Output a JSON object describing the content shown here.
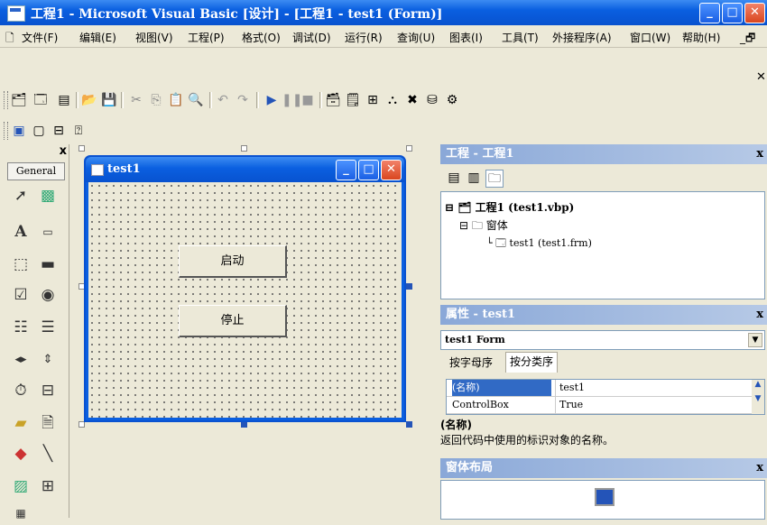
{
  "window": {
    "title": "工程1 - Microsoft Visual Basic [设计] - [工程1 - test1 (Form)]"
  },
  "menu": [
    "文件(F)",
    "编辑(E)",
    "视图(V)",
    "工程(P)",
    "格式(O)",
    "调试(D)",
    "运行(R)",
    "查询(U)",
    "图表(I)",
    "工具(T)",
    "外接程序(A)",
    "窗口(W)",
    "帮助(H)"
  ],
  "toolbox": {
    "tab_label": "General",
    "close": "x"
  },
  "form": {
    "title": "test1",
    "buttons": [
      {
        "label": "启动"
      },
      {
        "label": "停止"
      }
    ]
  },
  "project_panel": {
    "title": "工程 - 工程1",
    "close": "x",
    "tree": {
      "project": "工程1 (test1.vbp)",
      "folder": "窗体",
      "file": "test1 (test1.frm)"
    }
  },
  "properties_panel": {
    "title": "属性 - test1",
    "close": "x",
    "object_selector": "test1 Form",
    "tabs": [
      "按字母序",
      "按分类序"
    ],
    "rows": [
      {
        "name": "(名称)",
        "value": "test1"
      },
      {
        "name": "ControlBox",
        "value": "True"
      }
    ],
    "description_title": "(名称)",
    "description_text": "返回代码中使用的标识对象的名称。"
  },
  "layout_panel": {
    "title": "窗体布局",
    "close": "x"
  },
  "colors": {
    "xp_blue": "#0a5fe0",
    "panel_title": "#8aa8d8",
    "selected_row": "#316ac5",
    "face": "#ece9d8"
  }
}
